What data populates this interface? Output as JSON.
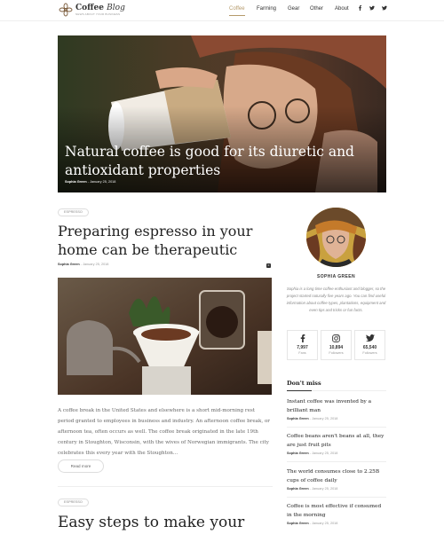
{
  "brand": {
    "title_bold": "Coffee",
    "title_italic": "Blog",
    "tagline": "News about your business"
  },
  "nav": {
    "items": [
      "Coffee",
      "Farming",
      "Gear",
      "Other",
      "About"
    ],
    "active": "Coffee",
    "social_icons": [
      "facebook-icon",
      "twitter-icon",
      "twitter-icon"
    ]
  },
  "colors": {
    "accent": "#b59a6b",
    "text": "#222222",
    "muted": "#999999"
  },
  "hero": {
    "title": "Natural coffee is good for its diuretic and antioxidant properties",
    "author": "Sophia Green",
    "date": "January 25, 2018"
  },
  "posts": [
    {
      "tag": "ESPRESSO",
      "title": "Preparing espresso in your home can be therapeutic",
      "author": "Sophia Green",
      "date": "January 25, 2018",
      "comments": "0",
      "excerpt": "A coffee break in the United States and elsewhere is a short mid-morning rest period granted to employees in business and industry. An afternoon coffee break, or afternoon tea, often occurs as well. The coffee break originated in the late 19th century in Stoughton, Wisconsin, with the wives of Norwegian immigrants. The city celebrates this every year with the Stoughton...",
      "read_more": "Read more"
    },
    {
      "tag": "ESPRESSO",
      "title": "Easy steps to make your"
    }
  ],
  "sidebar": {
    "author": "SOPHIA GREEN",
    "bio": "Sophia is a long time coffee enthusiast and blogger, so the project started naturally five years ago. You can find useful information about coffee types, plantations, equipment and even tips and tricks or fun facts.",
    "stats": [
      {
        "icon": "facebook-icon",
        "count": "7,997",
        "label": "Fans"
      },
      {
        "icon": "instagram-icon",
        "count": "10,894",
        "label": "Followers"
      },
      {
        "icon": "twitter-icon",
        "count": "65,540",
        "label": "Followers"
      }
    ],
    "dont_miss_title": "Don't miss",
    "dont_miss": [
      {
        "title": "Instant coffee was invented by a brilliant man",
        "author": "Sophia Green",
        "date": "January 25, 2018"
      },
      {
        "title": "Coffee beans aren't beans at all, they are just fruit pits",
        "author": "Sophia Green",
        "date": "January 25, 2018"
      },
      {
        "title": "The world consumes close to 2.25B cups of coffee daily",
        "author": "Sophia Green",
        "date": "January 25, 2018"
      },
      {
        "title": "Coffee is most effective if consumed in the morning",
        "author": "Sophia Green",
        "date": "January 25, 2018"
      }
    ]
  }
}
